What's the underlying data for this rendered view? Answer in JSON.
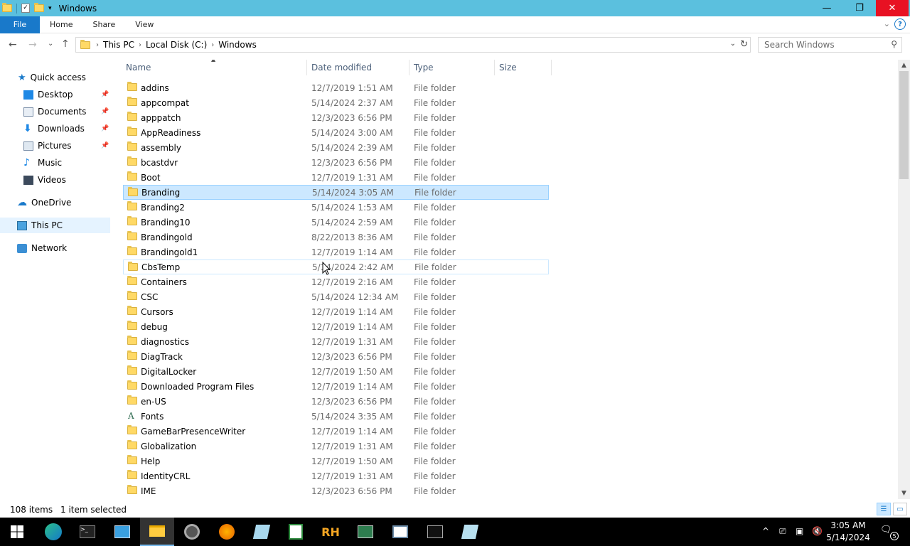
{
  "window": {
    "title": "Windows"
  },
  "ribbon": {
    "tabs": [
      "File",
      "Home",
      "Share",
      "View"
    ],
    "help": "?"
  },
  "address": {
    "crumbs": [
      "This PC",
      "Local Disk (C:)",
      "Windows"
    ],
    "search_placeholder": "Search Windows"
  },
  "sidebar": {
    "items": [
      {
        "label": "Quick access",
        "icon": "star-icon"
      },
      {
        "label": "Desktop",
        "icon": "desktop-icon",
        "pinned": true
      },
      {
        "label": "Documents",
        "icon": "documents-icon",
        "pinned": true
      },
      {
        "label": "Downloads",
        "icon": "downloads-icon",
        "pinned": true
      },
      {
        "label": "Pictures",
        "icon": "pictures-icon",
        "pinned": true
      },
      {
        "label": "Music",
        "icon": "music-icon"
      },
      {
        "label": "Videos",
        "icon": "videos-icon"
      },
      {
        "label": "OneDrive",
        "icon": "cloud-icon"
      },
      {
        "label": "This PC",
        "icon": "computer-icon",
        "selected": true
      },
      {
        "label": "Network",
        "icon": "network-icon"
      }
    ]
  },
  "columns": [
    "Name",
    "Date modified",
    "Type",
    "Size"
  ],
  "files": [
    {
      "name": "addins",
      "date": "12/7/2019 1:51 AM",
      "type": "File folder"
    },
    {
      "name": "appcompat",
      "date": "5/14/2024 2:37 AM",
      "type": "File folder"
    },
    {
      "name": "apppatch",
      "date": "12/3/2023 6:56 PM",
      "type": "File folder"
    },
    {
      "name": "AppReadiness",
      "date": "5/14/2024 3:00 AM",
      "type": "File folder"
    },
    {
      "name": "assembly",
      "date": "5/14/2024 2:39 AM",
      "type": "File folder"
    },
    {
      "name": "bcastdvr",
      "date": "12/3/2023 6:56 PM",
      "type": "File folder"
    },
    {
      "name": "Boot",
      "date": "12/7/2019 1:31 AM",
      "type": "File folder"
    },
    {
      "name": "Branding",
      "date": "5/14/2024 3:05 AM",
      "type": "File folder",
      "state": "selected"
    },
    {
      "name": "Branding2",
      "date": "5/14/2024 1:53 AM",
      "type": "File folder"
    },
    {
      "name": "Branding10",
      "date": "5/14/2024 2:59 AM",
      "type": "File folder"
    },
    {
      "name": "Brandingold",
      "date": "8/22/2013 8:36 AM",
      "type": "File folder"
    },
    {
      "name": "Brandingold1",
      "date": "12/7/2019 1:14 AM",
      "type": "File folder"
    },
    {
      "name": "CbsTemp",
      "date": "5/14/2024 2:42 AM",
      "type": "File folder",
      "state": "hover"
    },
    {
      "name": "Containers",
      "date": "12/7/2019 2:16 AM",
      "type": "File folder"
    },
    {
      "name": "CSC",
      "date": "5/14/2024 12:34 AM",
      "type": "File folder"
    },
    {
      "name": "Cursors",
      "date": "12/7/2019 1:14 AM",
      "type": "File folder"
    },
    {
      "name": "debug",
      "date": "12/7/2019 1:14 AM",
      "type": "File folder"
    },
    {
      "name": "diagnostics",
      "date": "12/7/2019 1:31 AM",
      "type": "File folder"
    },
    {
      "name": "DiagTrack",
      "date": "12/3/2023 6:56 PM",
      "type": "File folder"
    },
    {
      "name": "DigitalLocker",
      "date": "12/7/2019 1:50 AM",
      "type": "File folder"
    },
    {
      "name": "Downloaded Program Files",
      "date": "12/7/2019 1:14 AM",
      "type": "File folder"
    },
    {
      "name": "en-US",
      "date": "12/3/2023 6:56 PM",
      "type": "File folder"
    },
    {
      "name": "Fonts",
      "date": "5/14/2024 3:35 AM",
      "type": "File folder",
      "icon": "fonts-icon"
    },
    {
      "name": "GameBarPresenceWriter",
      "date": "12/7/2019 1:14 AM",
      "type": "File folder"
    },
    {
      "name": "Globalization",
      "date": "12/7/2019 1:31 AM",
      "type": "File folder"
    },
    {
      "name": "Help",
      "date": "12/7/2019 1:50 AM",
      "type": "File folder"
    },
    {
      "name": "IdentityCRL",
      "date": "12/7/2019 1:31 AM",
      "type": "File folder"
    },
    {
      "name": "IME",
      "date": "12/3/2023 6:56 PM",
      "type": "File folder"
    }
  ],
  "status": {
    "count": "108 items",
    "selection": "1 item selected"
  },
  "taskbar": {
    "apps": [
      "edge-icon",
      "terminal-icon",
      "control-panel-icon",
      "file-explorer-icon",
      "chrome-icon",
      "firefox-icon",
      "notepad-icon",
      "spreadsheet-icon",
      "rh-app-icon",
      "server-manager-icon",
      "window-icon",
      "cmd-icon",
      "wordpad-icon"
    ],
    "rh_label": "RH",
    "time": "3:05 AM",
    "date": "5/14/2024",
    "notif_count": "5"
  }
}
